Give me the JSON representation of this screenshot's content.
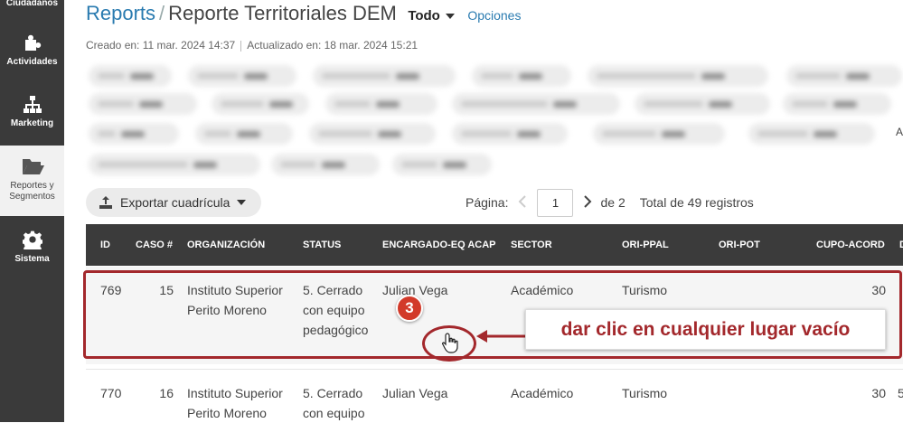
{
  "sidebar": {
    "items": [
      {
        "label": "Ciudadanos",
        "icon": "users-icon"
      },
      {
        "label": "Actividades",
        "icon": "puzzle-icon"
      },
      {
        "label": "Marketing",
        "icon": "sitemap-icon"
      },
      {
        "label": "Reportes y Segmentos",
        "icon": "folder-open-icon"
      },
      {
        "label": "Sistema",
        "icon": "gear-icon"
      }
    ]
  },
  "header": {
    "breadcrumb_root": "Reports",
    "separator": "/",
    "title": "Reporte Territoriales DEM",
    "view_select": "Todo",
    "options_link": "Opciones"
  },
  "meta": {
    "created": "Creado en: 11 mar. 2024 14:37",
    "updated": "Actualizado en: 18 mar. 2024 15:21"
  },
  "filters": {
    "overflow_label": "A"
  },
  "toolbar": {
    "export_label": "Exportar cuadrícula",
    "page_label": "Página:",
    "page_value": "1",
    "page_of": "de 2",
    "total": "Total de 49 registros"
  },
  "table": {
    "columns": [
      "ID",
      "CASO #",
      "ORGANIZACIÓN",
      "STATUS",
      "ENCARGADO-EQ ACAP",
      "SECTOR",
      "ORI-PPAL",
      "ORI-POT",
      "CUPO-ACORD",
      "D"
    ],
    "rows": [
      {
        "id": "769",
        "caso": "15",
        "org": "Instituto Superior Perito Moreno",
        "status": "5. Cerrado con equipo pedagógico",
        "encargado": "Julian Vega",
        "sector": "Académico",
        "ori_ppal": "Turismo",
        "ori_pot": "",
        "cupo": "30"
      },
      {
        "id": "770",
        "caso": "16",
        "org": "Instituto Superior Perito Moreno",
        "status": "5. Cerrado con equipo",
        "encargado": "Julian Vega",
        "sector": "Académico",
        "ori_ppal": "Turismo",
        "ori_pot": "",
        "cupo": "30",
        "extra": "5"
      }
    ]
  },
  "annotation": {
    "step_number": "3",
    "callout_text": "dar clic en cualquier lugar vacío",
    "accent_color": "#a3282c"
  },
  "colors": {
    "sidebar_bg": "#3a3a3a",
    "header_bg": "#3b3b3b",
    "link": "#2a7bb0"
  }
}
